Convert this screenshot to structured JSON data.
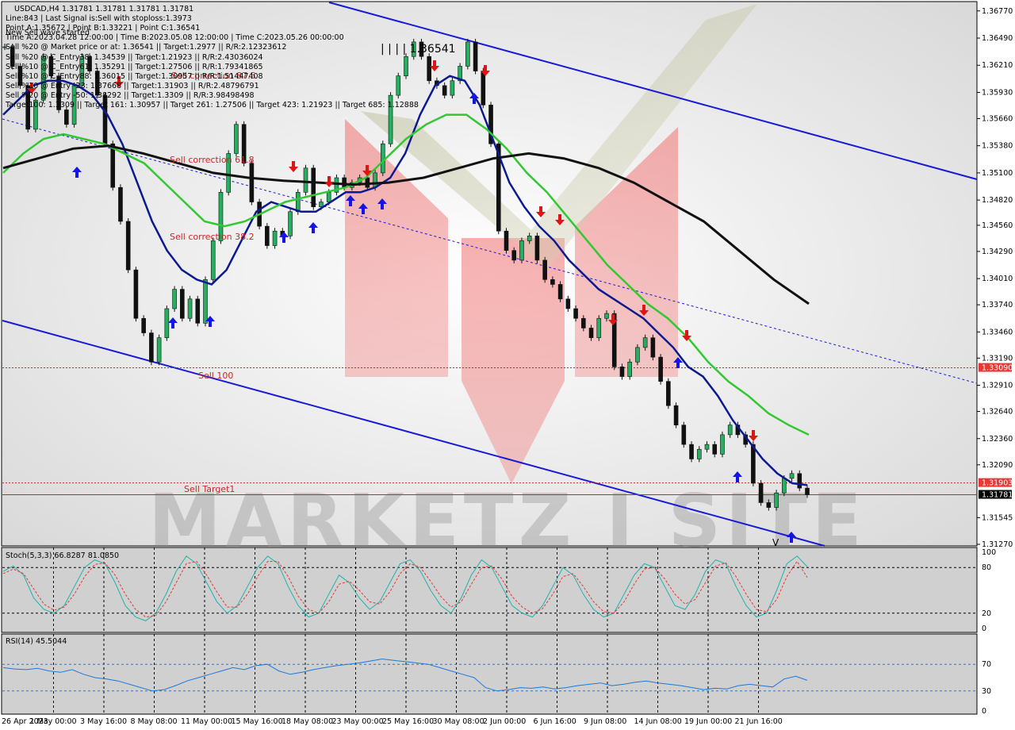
{
  "chart_data": [
    {
      "type": "line",
      "name": "price",
      "ylim": [
        1.3127,
        1.3685
      ],
      "y_ticks": [
        "1.36770",
        "1.36490",
        "1.36210",
        "1.35930",
        "1.35660",
        "1.35380",
        "1.35100",
        "1.34820",
        "1.34560",
        "1.34290",
        "1.34010",
        "1.33740",
        "1.33460",
        "1.33190",
        "1.32910",
        "1.32640",
        "1.32360",
        "1.32090",
        "1.31545",
        "1.31270"
      ],
      "x_ticks": [
        "26 Apr 2023",
        "1 May 00:00",
        "3 May 16:00",
        "8 May 08:00",
        "11 May 00:00",
        "15 May 16:00",
        "18 May 08:00",
        "23 May 00:00",
        "25 May 16:00",
        "30 May 08:00",
        "2 Jun 00:00",
        "6 Jun 16:00",
        "9 Jun 08:00",
        "14 Jun 08:00",
        "19 Jun 00:00",
        "21 Jun 16:00"
      ],
      "price_labels": [
        {
          "text": "1.33090",
          "value": 1.3309,
          "color": "#e53935"
        },
        {
          "text": "1.31903",
          "value": 1.31903,
          "color": "#e53935"
        },
        {
          "text": "1.31781",
          "value": 1.31781,
          "color": "#000000"
        }
      ],
      "horizontal_levels": [
        {
          "value": 1.3309,
          "style": "dotted",
          "color": "#c62828"
        },
        {
          "value": 1.31903,
          "style": "dotted",
          "color": "#c62828"
        },
        {
          "value": 1.31781,
          "style": "solid",
          "color": "#c62828"
        }
      ],
      "annotations": [
        {
          "text": "Sell correction 61.8",
          "color": "#c62828"
        },
        {
          "text": "Sell correction 38.2",
          "color": "#c62828"
        },
        {
          "text": "Sell 100",
          "color": "#c62828"
        },
        {
          "text": "Sell Target1",
          "color": "#c62828"
        },
        {
          "text": "| | | | 1.36541",
          "color": "#000000"
        },
        {
          "text": "Sell correction 87.5",
          "color": "#c62828"
        },
        {
          "text": "V",
          "color": "#000000"
        }
      ],
      "series": [
        {
          "name": "price",
          "color": "#000000",
          "values": [
            1.364,
            1.362,
            1.36,
            1.3555,
            1.3585,
            1.363,
            1.361,
            1.3575,
            1.356,
            1.36,
            1.363,
            1.3615,
            1.359,
            1.354,
            1.3495,
            1.346,
            1.341,
            1.336,
            1.3345,
            1.3315,
            1.334,
            1.337,
            1.339,
            1.336,
            1.338,
            1.3355,
            1.34,
            1.344,
            1.349,
            1.353,
            1.356,
            1.352,
            1.348,
            1.3455,
            1.3435,
            1.345,
            1.3445,
            1.347,
            1.349,
            1.3515,
            1.3475,
            1.348,
            1.349,
            1.3505,
            1.3495,
            1.35,
            1.3505,
            1.3495,
            1.351,
            1.354,
            1.359,
            1.361,
            1.363,
            1.3645,
            1.363,
            1.3605,
            1.36,
            1.359,
            1.3605,
            1.362,
            1.3645,
            1.3615,
            1.358,
            1.354,
            1.345,
            1.343,
            1.342,
            1.344,
            1.3445,
            1.342,
            1.34,
            1.3395,
            1.338,
            1.337,
            1.336,
            1.335,
            1.334,
            1.336,
            1.3365,
            1.331,
            1.33,
            1.3315,
            1.333,
            1.334,
            1.332,
            1.3295,
            1.327,
            1.325,
            1.323,
            1.3215,
            1.3225,
            1.323,
            1.322,
            1.324,
            1.325,
            1.324,
            1.323,
            1.319,
            1.317,
            1.3165,
            1.318,
            1.3195,
            1.32,
            1.3185,
            1.31781
          ]
        },
        {
          "name": "ma-blue",
          "color": "#0d1a8f",
          "values": [
            1.357,
            1.3585,
            1.36,
            1.3605,
            1.3605,
            1.36,
            1.359,
            1.357,
            1.354,
            1.35,
            1.346,
            1.343,
            1.341,
            1.34,
            1.3395,
            1.341,
            1.344,
            1.347,
            1.348,
            1.3475,
            1.347,
            1.347,
            1.348,
            1.349,
            1.349,
            1.3495,
            1.3505,
            1.353,
            1.357,
            1.36,
            1.361,
            1.3605,
            1.358,
            1.354,
            1.35,
            1.3475,
            1.3455,
            1.344,
            1.342,
            1.3405,
            1.339,
            1.338,
            1.337,
            1.336,
            1.3345,
            1.333,
            1.331,
            1.33,
            1.328,
            1.3255,
            1.3235,
            1.3215,
            1.32,
            1.319,
            1.3188
          ]
        },
        {
          "name": "ma-green",
          "color": "#32c832",
          "values": [
            1.351,
            1.353,
            1.3545,
            1.355,
            1.3545,
            1.354,
            1.353,
            1.352,
            1.35,
            1.348,
            1.346,
            1.3455,
            1.346,
            1.347,
            1.348,
            1.3485,
            1.349,
            1.3495,
            1.3505,
            1.3525,
            1.3545,
            1.356,
            1.357,
            1.357,
            1.3555,
            1.3535,
            1.351,
            1.349,
            1.3465,
            1.344,
            1.3415,
            1.3395,
            1.3375,
            1.336,
            1.334,
            1.3315,
            1.3295,
            1.328,
            1.3262,
            1.325,
            1.324
          ]
        },
        {
          "name": "ma-black",
          "color": "#111111",
          "values": [
            1.3515,
            1.3525,
            1.3535,
            1.3538,
            1.353,
            1.352,
            1.351,
            1.3505,
            1.3502,
            1.35,
            1.3498,
            1.35,
            1.3505,
            1.3515,
            1.3525,
            1.353,
            1.3525,
            1.3515,
            1.35,
            1.348,
            1.346,
            1.343,
            1.34,
            1.3375
          ]
        }
      ]
    },
    {
      "type": "line",
      "name": "stochastic",
      "label": "Stoch(5,3,3) 66.8287 81.0850",
      "ylim": [
        0,
        100
      ],
      "y_ticks": [
        "100",
        "80",
        "20",
        "0"
      ],
      "levels": [
        80,
        20
      ],
      "series": [
        {
          "name": "%K",
          "color": "#20b2aa",
          "values": [
            75,
            82,
            70,
            40,
            25,
            20,
            30,
            55,
            80,
            90,
            85,
            60,
            30,
            15,
            10,
            20,
            45,
            75,
            95,
            85,
            60,
            35,
            20,
            30,
            55,
            80,
            95,
            85,
            55,
            30,
            15,
            20,
            45,
            70,
            60,
            40,
            25,
            35,
            60,
            85,
            90,
            75,
            50,
            30,
            20,
            40,
            70,
            90,
            80,
            55,
            30,
            20,
            15,
            30,
            55,
            80,
            70,
            45,
            25,
            15,
            20,
            45,
            70,
            85,
            80,
            55,
            30,
            25,
            45,
            75,
            90,
            85,
            55,
            30,
            15,
            20,
            50,
            85,
            95,
            81
          ]
        },
        {
          "name": "%D",
          "color": "#e53935",
          "values": [
            72,
            78,
            72,
            52,
            32,
            24,
            28,
            45,
            68,
            84,
            86,
            70,
            45,
            25,
            15,
            17,
            35,
            60,
            85,
            88,
            70,
            48,
            28,
            28,
            45,
            68,
            88,
            88,
            68,
            42,
            25,
            20,
            35,
            58,
            62,
            50,
            35,
            32,
            48,
            72,
            85,
            80,
            62,
            42,
            28,
            35,
            58,
            80,
            82,
            65,
            42,
            28,
            20,
            26,
            45,
            68,
            72,
            55,
            35,
            22,
            20,
            35,
            58,
            78,
            80,
            65,
            45,
            32,
            38,
            60,
            82,
            86,
            68,
            45,
            25,
            22,
            38,
            68,
            88,
            67
          ]
        }
      ]
    },
    {
      "type": "line",
      "name": "rsi",
      "label": "RSI(14) 45.5044",
      "ylim": [
        0,
        100
      ],
      "y_ticks": [
        "70",
        "30",
        "0"
      ],
      "levels": [
        70,
        30
      ],
      "series": [
        {
          "name": "RSI",
          "color": "#1e78dc",
          "values": [
            65,
            63,
            62,
            64,
            60,
            58,
            62,
            55,
            50,
            48,
            45,
            40,
            35,
            30,
            32,
            38,
            45,
            50,
            55,
            60,
            65,
            62,
            68,
            70,
            60,
            55,
            58,
            62,
            65,
            68,
            70,
            72,
            75,
            78,
            76,
            74,
            72,
            70,
            65,
            60,
            55,
            50,
            35,
            30,
            32,
            35,
            34,
            36,
            33,
            35,
            38,
            40,
            42,
            38,
            40,
            43,
            45,
            42,
            40,
            38,
            35,
            32,
            34,
            33,
            38,
            40,
            38,
            36,
            48,
            52,
            46
          ]
        }
      ]
    }
  ],
  "header": {
    "symbol_line": "USDCAD,H4  1.31781 1.31781 1.31781 1.31781",
    "info_lines": [
      "Line:843 | Last Signal is:Sell with stoploss:1.3973",
      "Point A:1.35672 | Point B:1.33221 | Point C:1.36541",
      "Time A:2023.04.28 12:00:00 | Time B:2023.05.08 12:00:00 | Time C:2023.05.26 00:00:00",
      "Sell %20 @ Market price or at: 1.36541 || Target:1.2977 || R/R:2.12323612",
      "Sell %20 @ C_Entry38: 1.34539 || Target:1.21923 || R/R:2.43036024",
      "Sell %10 @ C_Entry61: 1.35291 || Target:1.27506 || R/R:1.79341865",
      "Sell %10 @ C_Entry88: 1.36015 || Target:1.30957 || R/R:1.51447408",
      "Sell %10 @ Entry -23: 1.37668 || Target:1.31903 || R/R:2.48796791",
      "Sell %20 @ Entry -50: 1.38292 || Target:1.3309 || R/R:3.98498498",
      "Target100: 1.3309 || Target 161: 1.30957 || Target 261: 1.27506 || Target 423: 1.21923 || Target 685: 1.12888"
    ],
    "status_line": "New Sell wave started"
  },
  "watermark": {
    "text": "MARKETZ I SITE"
  }
}
